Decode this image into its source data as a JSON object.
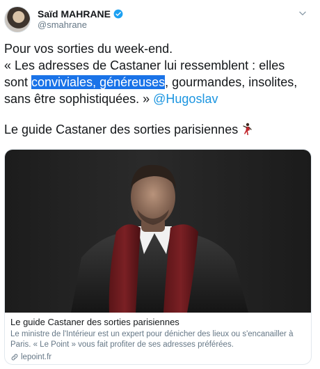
{
  "author": {
    "display_name": "Saïd MAHRANE",
    "handle": "@smahrane"
  },
  "tweet": {
    "line1": "Pour vos sorties du week-end.",
    "line2_prefix": "« Les adresses de Castaner lui ressemblent : elles sont ",
    "line2_highlight": "conviviales, généreuses",
    "line2_suffix": ", gourmandes, insolites, sans être sophistiquées. » ",
    "mention": "@Hugoslav",
    "line3": "Le guide Castaner des sorties parisiennes"
  },
  "card": {
    "title": "Le guide Castaner des sorties parisiennes",
    "description": "Le ministre de l'Intérieur est un expert pour dénicher des lieux ou s'encanailler à Paris. « Le Point » vous fait profiter de ses adresses préférées.",
    "domain": "lepoint.fr"
  },
  "colors": {
    "link": "#1b95e0",
    "highlight": "#1a73e8",
    "verified": "#1da1f2"
  }
}
